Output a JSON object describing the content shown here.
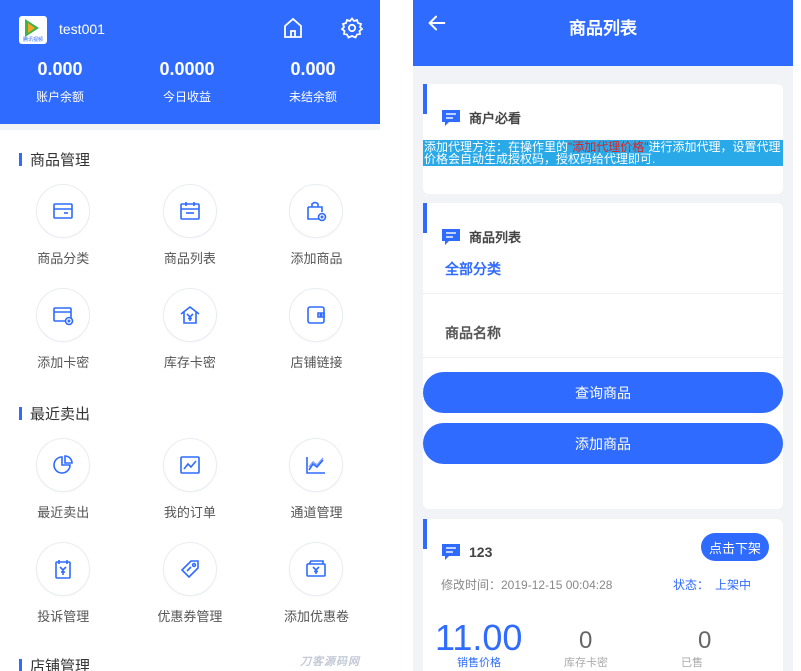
{
  "left": {
    "logo_text": "腾讯视频",
    "username": "test001",
    "icons": {
      "home": "home-icon",
      "settings": "gear-icon"
    },
    "stats": [
      {
        "value": "0.000",
        "label": "账户余额"
      },
      {
        "value": "0.0000",
        "label": "今日收益"
      },
      {
        "value": "0.000",
        "label": "未结余额"
      }
    ],
    "sections": [
      {
        "title": "商品管理",
        "items": [
          {
            "label": "商品分类",
            "icon": "category-icon"
          },
          {
            "label": "商品列表",
            "icon": "product-list-icon"
          },
          {
            "label": "添加商品",
            "icon": "add-product-icon"
          },
          {
            "label": "添加卡密",
            "icon": "add-card-icon"
          },
          {
            "label": "库存卡密",
            "icon": "stock-card-icon"
          },
          {
            "label": "店铺链接",
            "icon": "shop-link-icon"
          }
        ]
      },
      {
        "title": "最近卖出",
        "items": [
          {
            "label": "最近卖出",
            "icon": "pie-chart-icon"
          },
          {
            "label": "我的订单",
            "icon": "line-chart-icon"
          },
          {
            "label": "通道管理",
            "icon": "area-chart-icon"
          },
          {
            "label": "投诉管理",
            "icon": "complaint-icon"
          },
          {
            "label": "优惠券管理",
            "icon": "coupon-tag-icon"
          },
          {
            "label": "添加优惠卷",
            "icon": "add-coupon-icon"
          }
        ]
      },
      {
        "title": "店铺管理"
      }
    ]
  },
  "right": {
    "title": "商品列表",
    "notice_card": {
      "title": "商户必看",
      "notice_prefix": "添加代理方法：在操作里的",
      "notice_highlight": "\"添加代理价格\"",
      "notice_suffix": "进行添加代理，设置代理价格会自动生成授权码，授权码给代理即可."
    },
    "list_card": {
      "title": "商品列表",
      "category_value": "全部分类",
      "name_placeholder": "商品名称",
      "query_button": "查询商品",
      "add_button": "添加商品"
    },
    "product": {
      "name": "123",
      "unlist_button": "点击下架",
      "modified_time": "修改时间：2019-12-15 00:04:28",
      "status_label": "状态：",
      "status_value": "上架中",
      "price": "11.00",
      "price_label": "销售价格",
      "stock": "0",
      "stock_label": "库存卡密",
      "sold": "0",
      "sold_label": "已售"
    }
  },
  "watermark": "刀客源码网",
  "colors": {
    "primary": "#2f6bff",
    "notice_bg": "#29a9e8",
    "highlight": "#e02020"
  }
}
